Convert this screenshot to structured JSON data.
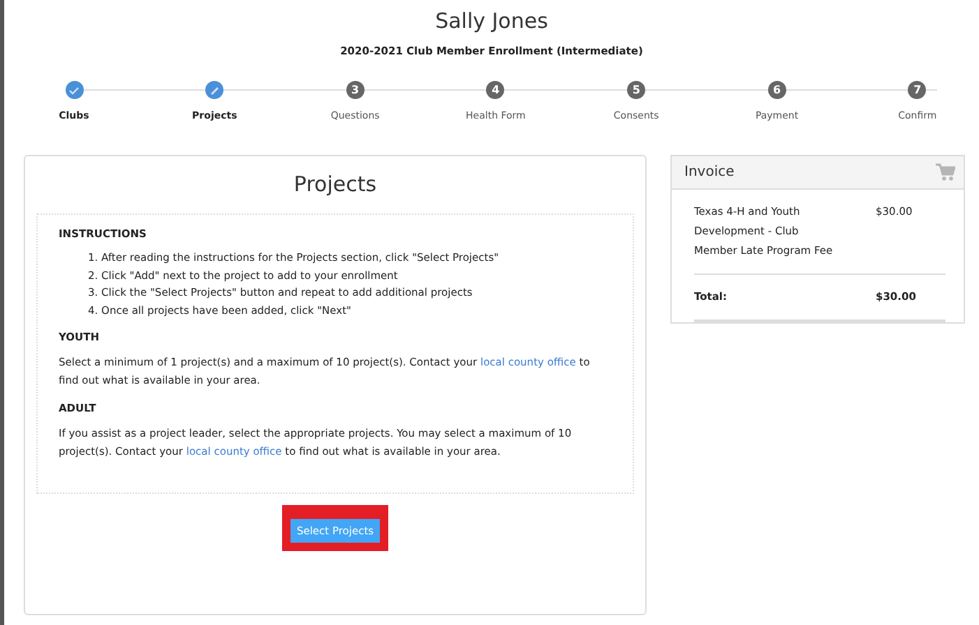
{
  "header": {
    "name": "Sally Jones",
    "subtitle": "2020-2021 Club Member Enrollment (Intermediate)"
  },
  "steps": [
    {
      "label": "Clubs",
      "kind": "done"
    },
    {
      "label": "Projects",
      "kind": "current"
    },
    {
      "label": "Questions",
      "kind": "pending",
      "number": "3"
    },
    {
      "label": "Health Form",
      "kind": "pending",
      "number": "4"
    },
    {
      "label": "Consents",
      "kind": "pending",
      "number": "5"
    },
    {
      "label": "Payment",
      "kind": "pending",
      "number": "6"
    },
    {
      "label": "Confirm",
      "kind": "pending",
      "number": "7"
    }
  ],
  "panel": {
    "title": "Projects",
    "instructions_heading": "INSTRUCTIONS",
    "instructions": [
      {
        "marker": "1.",
        "text": "After reading the instructions for the Projects section, click \"Select Projects\""
      },
      {
        "marker": "2.",
        "text": "Click \"Add\" next to the project to add to your enrollment"
      },
      {
        "marker": "3.",
        "text": "Click the \"Select Projects\" button and repeat to add additional projects"
      },
      {
        "marker": "4.",
        "text": "Once all projects have been added, click \"Next\""
      }
    ],
    "sections": [
      {
        "heading": "YOUTH",
        "before": "Select a minimum of 1 project(s) and a maximum of 10 project(s). Contact your ",
        "link": "local county office",
        "after": " to find out what is available in your area."
      },
      {
        "heading": "ADULT",
        "before": "If you assist as a project leader, select the appropriate projects.  You may select a maximum of 10 project(s). Contact your  ",
        "link": "local county office",
        "after": " to find out what is available in your area."
      }
    ],
    "button": "Select Projects"
  },
  "invoice": {
    "title": "Invoice",
    "items": [
      {
        "description": "Texas 4-H and Youth Development - Club Member Late Program Fee",
        "amount": "$30.00"
      }
    ],
    "total_label": "Total:",
    "total": "$30.00"
  }
}
